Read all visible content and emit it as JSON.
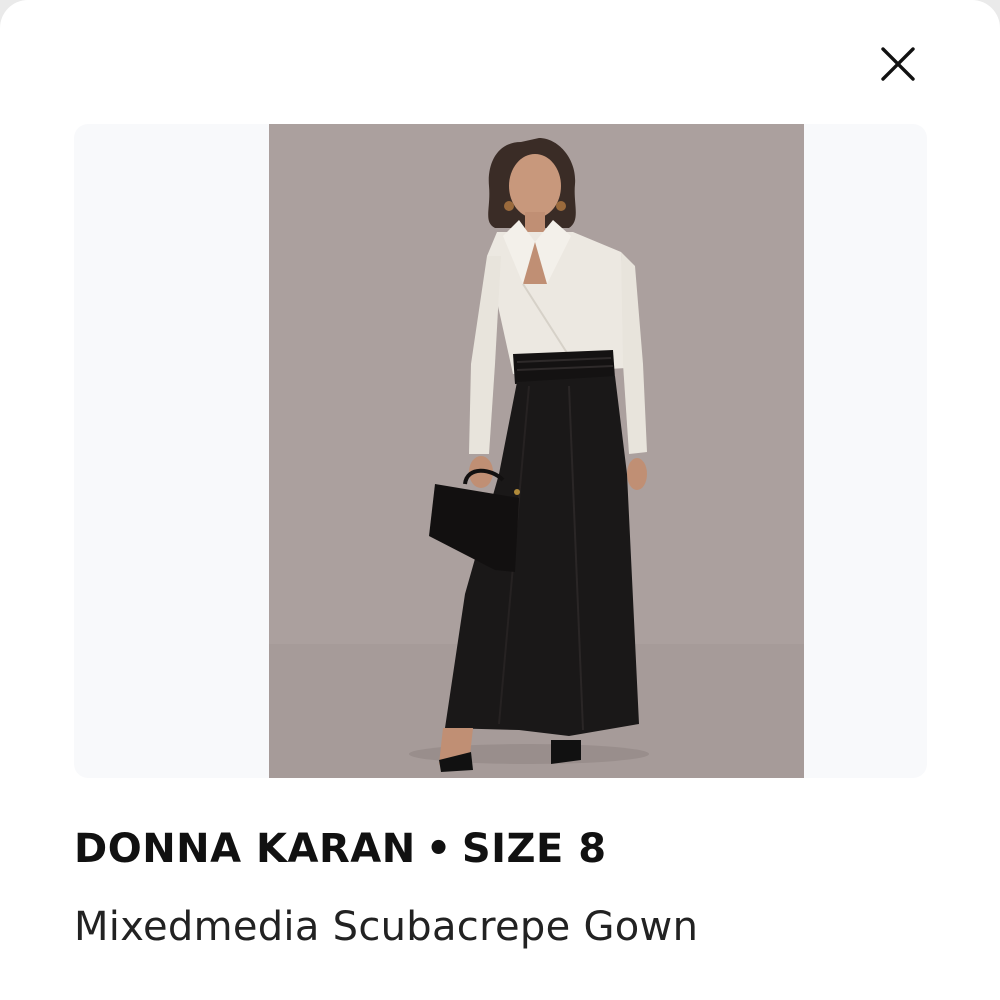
{
  "close_icon": "close-icon",
  "product": {
    "brand": "DONNA KARAN",
    "separator": "•",
    "size": "SIZE 8",
    "name": "Mixedmedia Scubacrepe Gown"
  },
  "image": {
    "alt": "Model wearing a white wrap blouse with black satin cummerbund and long black gown skirt, holding a black handbag",
    "background_color": "#aba09e"
  }
}
